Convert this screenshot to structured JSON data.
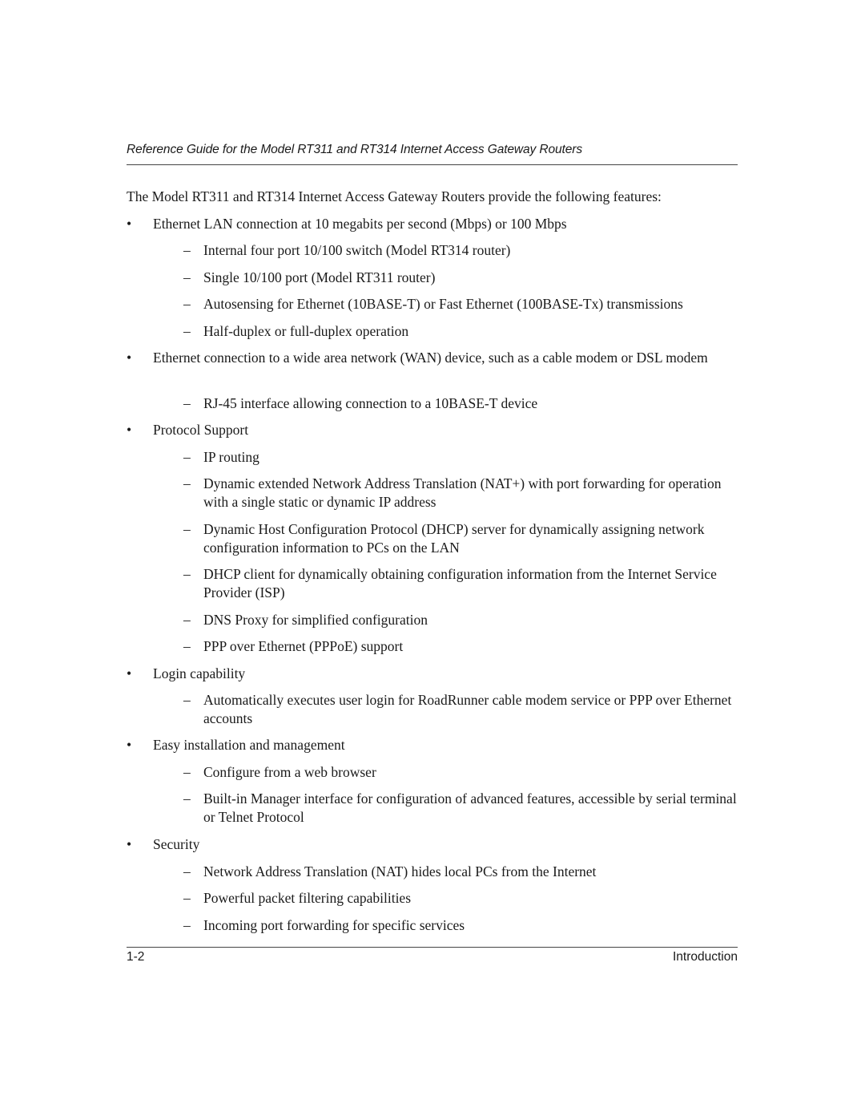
{
  "header": {
    "running_title": "Reference Guide for the Model RT311 and RT314 Internet Access Gateway Routers"
  },
  "content": {
    "intro": "The Model RT311 and RT314 Internet Access Gateway Routers provide the following features:",
    "bullet_marker": "•",
    "dash_marker": "–",
    "items": [
      {
        "level": 1,
        "text": "Ethernet LAN connection at 10 megabits per second (Mbps) or 100 Mbps"
      },
      {
        "level": 2,
        "text": "Internal four port 10/100 switch (Model RT314 router)"
      },
      {
        "level": 2,
        "text": "Single 10/100 port (Model RT311 router)"
      },
      {
        "level": 2,
        "text": "Autosensing for Ethernet (10BASE-T) or Fast Ethernet (100BASE-Tx) transmissions"
      },
      {
        "level": 2,
        "text": "Half-duplex or full-duplex operation"
      },
      {
        "level": 1,
        "text": "Ethernet connection to a wide area network (WAN) device, such as a cable modem or DSL modem"
      },
      {
        "level": 2,
        "text": "RJ-45 interface allowing connection to a 10BASE-T device"
      },
      {
        "level": 1,
        "text": "Protocol Support"
      },
      {
        "level": 2,
        "text": "IP routing"
      },
      {
        "level": 2,
        "text": "Dynamic extended Network Address Translation (NAT+) with port forwarding for operation with a single static or dynamic IP address"
      },
      {
        "level": 2,
        "text": "Dynamic Host Configuration Protocol (DHCP) server for dynamically assigning network configuration information to PCs on the LAN"
      },
      {
        "level": 2,
        "text": "DHCP client for dynamically obtaining configuration information from the Internet Service Provider (ISP)"
      },
      {
        "level": 2,
        "text": "DNS Proxy for simplified configuration"
      },
      {
        "level": 2,
        "text": "PPP over Ethernet (PPPoE) support"
      },
      {
        "level": 1,
        "text": "Login capability"
      },
      {
        "level": 2,
        "text": "Automatically executes user login for RoadRunner cable modem service or PPP over Ethernet accounts"
      },
      {
        "level": 1,
        "text": "Easy installation and management"
      },
      {
        "level": 2,
        "text": "Configure from a web browser"
      },
      {
        "level": 2,
        "text": "Built-in Manager interface for configuration of advanced features, accessible by serial terminal or Telnet Protocol"
      },
      {
        "level": 1,
        "text": "Security"
      },
      {
        "level": 2,
        "text": "Network Address Translation (NAT) hides local PCs from the Internet"
      },
      {
        "level": 2,
        "text": "Powerful packet filtering capabilities"
      },
      {
        "level": 2,
        "text": "Incoming port forwarding for specific services"
      }
    ]
  },
  "footer": {
    "page_number": "1-2",
    "section": "Introduction"
  }
}
